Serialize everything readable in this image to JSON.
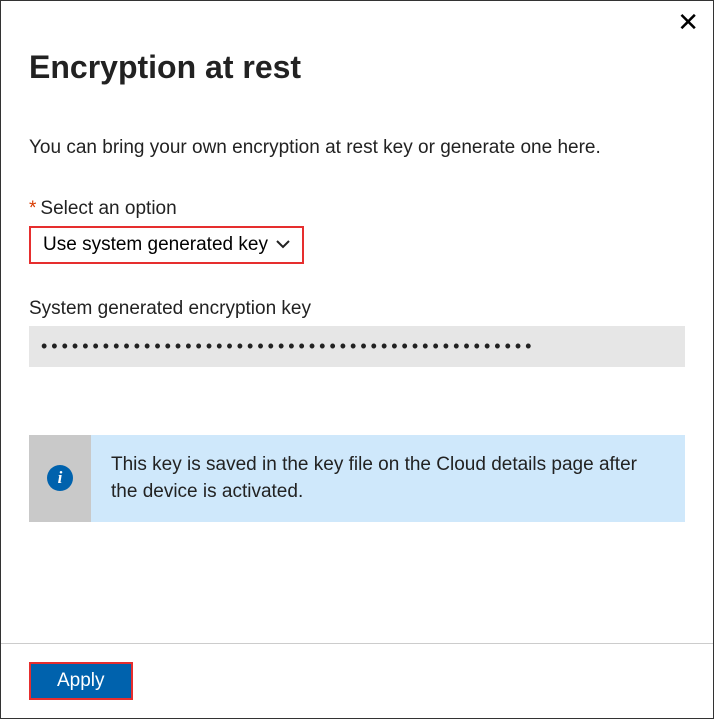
{
  "header": {
    "title": "Encryption at rest"
  },
  "body": {
    "description": "You can bring your own encryption at rest key or generate one here.",
    "option_label": "Select an option",
    "option_value": "Use system generated key",
    "key_label": "System generated encryption key",
    "key_value": "••••••••••••••••••••••••••••••••••••••••••••••••",
    "info_text": "This key is saved in the key file on the Cloud details page after the device is activated."
  },
  "footer": {
    "apply_label": "Apply"
  }
}
